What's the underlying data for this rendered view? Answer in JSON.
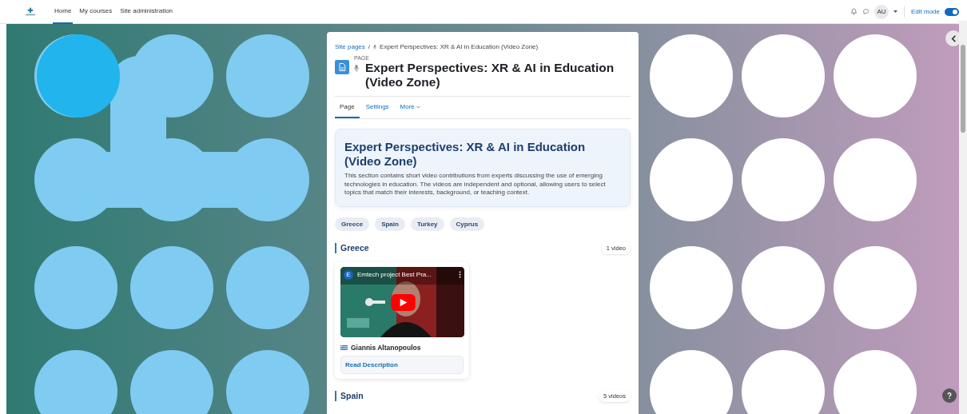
{
  "navbar": {
    "links": [
      {
        "label": "Home",
        "selected": true
      },
      {
        "label": "My courses",
        "selected": false
      },
      {
        "label": "Site administration",
        "selected": false
      }
    ],
    "user_initials": "AU",
    "edit_mode": {
      "label": "Edit mode",
      "on": true
    }
  },
  "breadcrumb": {
    "items": [
      "Site pages",
      "Expert Perspectives: XR & AI in Education (Video Zone)"
    ],
    "separator": "/"
  },
  "page": {
    "kind_label": "PAGE",
    "title": "Expert Perspectives: XR & AI in Education (Video Zone)"
  },
  "tabs": [
    {
      "label": "Page",
      "selected": true
    },
    {
      "label": "Settings",
      "selected": false
    },
    {
      "label": "More",
      "selected": false
    }
  ],
  "intro": {
    "title": "Expert Perspectives: XR & AI in Education (Video Zone)",
    "text": "This section contains short video contributions from experts discussing the use of emerging technologies in education. The videos are independent and optional, allowing users to select topics that match their interests, background, or teaching context."
  },
  "filters": [
    "Greece",
    "Spain",
    "Turkey",
    "Cyprus"
  ],
  "sections": [
    {
      "title": "Greece",
      "count": "1 video",
      "videos": [
        {
          "channel_initial": "E",
          "video_title": "Emtech project Best Pra...",
          "speaker": "Giannis Altanopoulos",
          "link": "Read Description"
        }
      ]
    },
    {
      "title": "Spain",
      "count": "5 videos"
    }
  ]
}
